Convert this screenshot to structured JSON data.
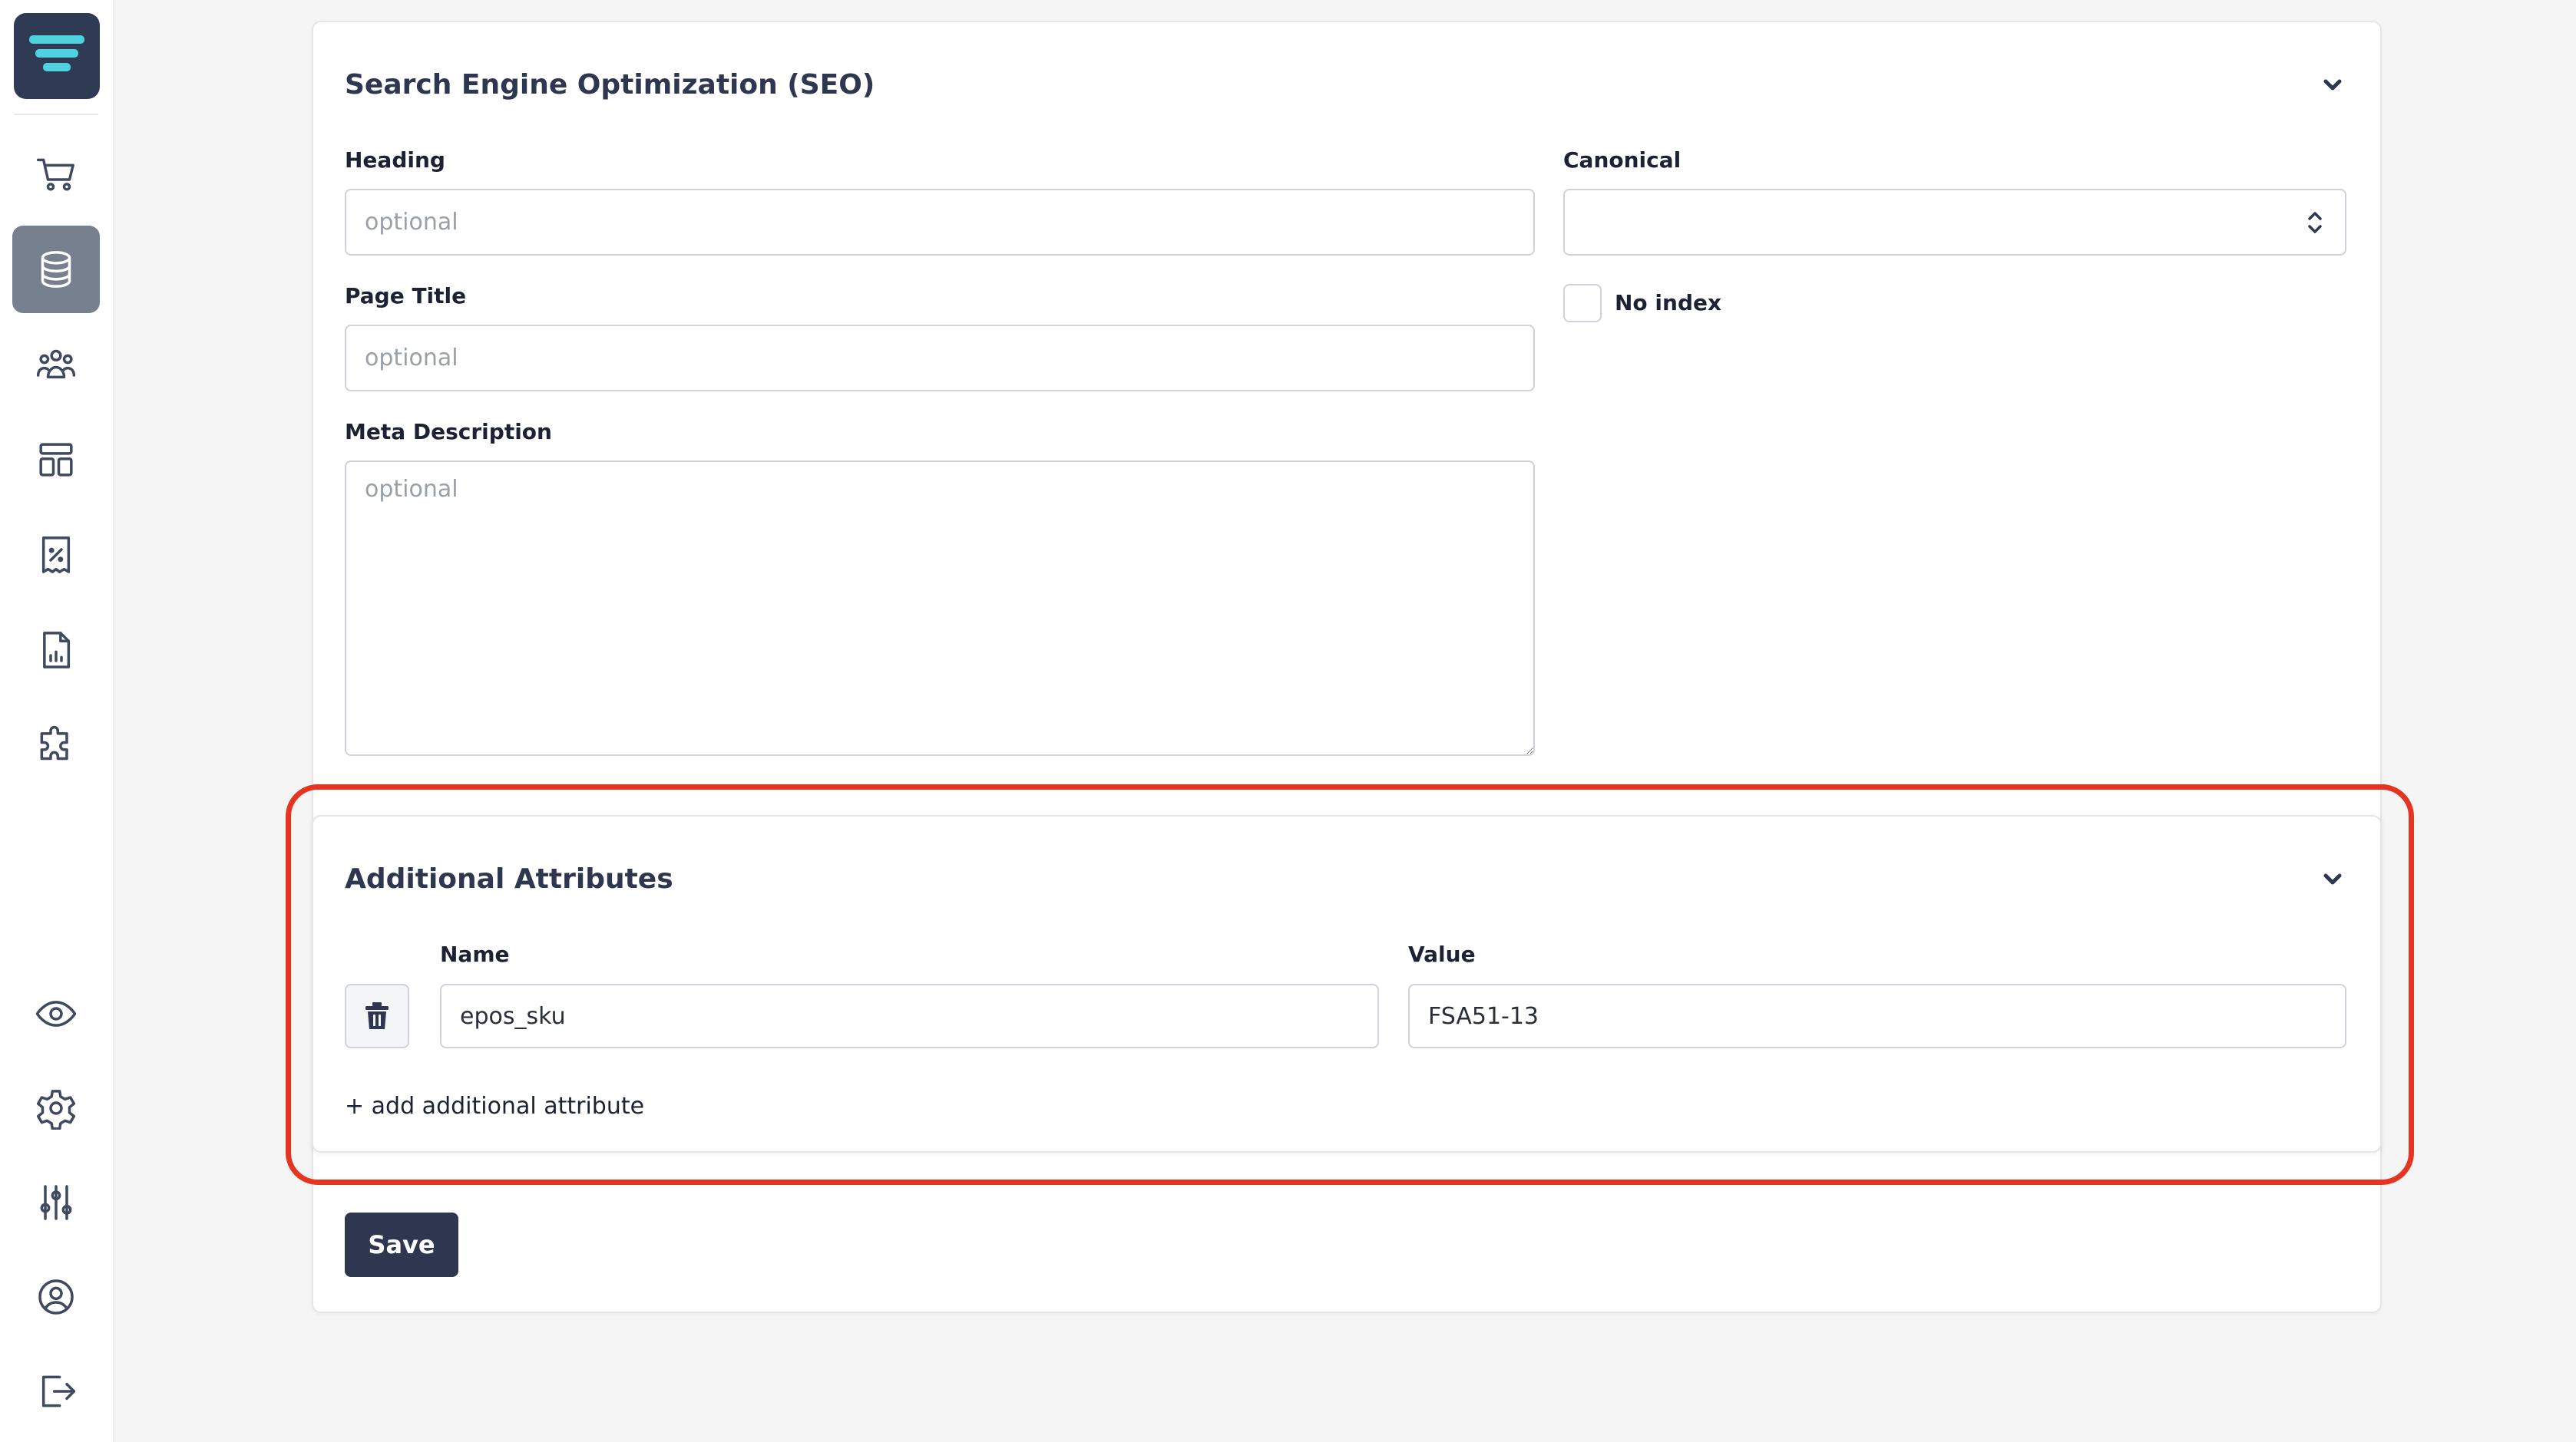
{
  "sidebar": {
    "logo_icon": "brand-logo-icon",
    "items": [
      {
        "icon": "cart-icon",
        "active": false
      },
      {
        "icon": "database-icon",
        "active": true
      },
      {
        "icon": "users-icon",
        "active": false
      },
      {
        "icon": "layout-icon",
        "active": false
      },
      {
        "icon": "receipt-percent-icon",
        "active": false
      },
      {
        "icon": "document-chart-icon",
        "active": false
      },
      {
        "icon": "puzzle-icon",
        "active": false
      }
    ],
    "bottom_items": [
      {
        "icon": "eye-icon"
      },
      {
        "icon": "gear-icon"
      },
      {
        "icon": "sliders-icon"
      },
      {
        "icon": "user-circle-icon"
      },
      {
        "icon": "logout-icon"
      }
    ]
  },
  "seo": {
    "title": "Search Engine Optimization (SEO)",
    "heading_label": "Heading",
    "heading_placeholder": "optional",
    "heading_value": "",
    "page_title_label": "Page Title",
    "page_title_placeholder": "optional",
    "page_title_value": "",
    "meta_description_label": "Meta Description",
    "meta_description_placeholder": "optional",
    "meta_description_value": "",
    "canonical_label": "Canonical",
    "canonical_value": "",
    "no_index_label": "No index",
    "no_index_checked": false
  },
  "additional_attributes": {
    "title": "Additional Attributes",
    "name_label": "Name",
    "value_label": "Value",
    "rows": [
      {
        "name": "epos_sku",
        "value": "FSA51-13"
      }
    ],
    "add_link": "+ add additional attribute"
  },
  "actions": {
    "save_label": "Save"
  },
  "colors": {
    "accent_highlight": "#e5341f",
    "primary_button": "#2f3650",
    "active_nav": "#77808f"
  }
}
